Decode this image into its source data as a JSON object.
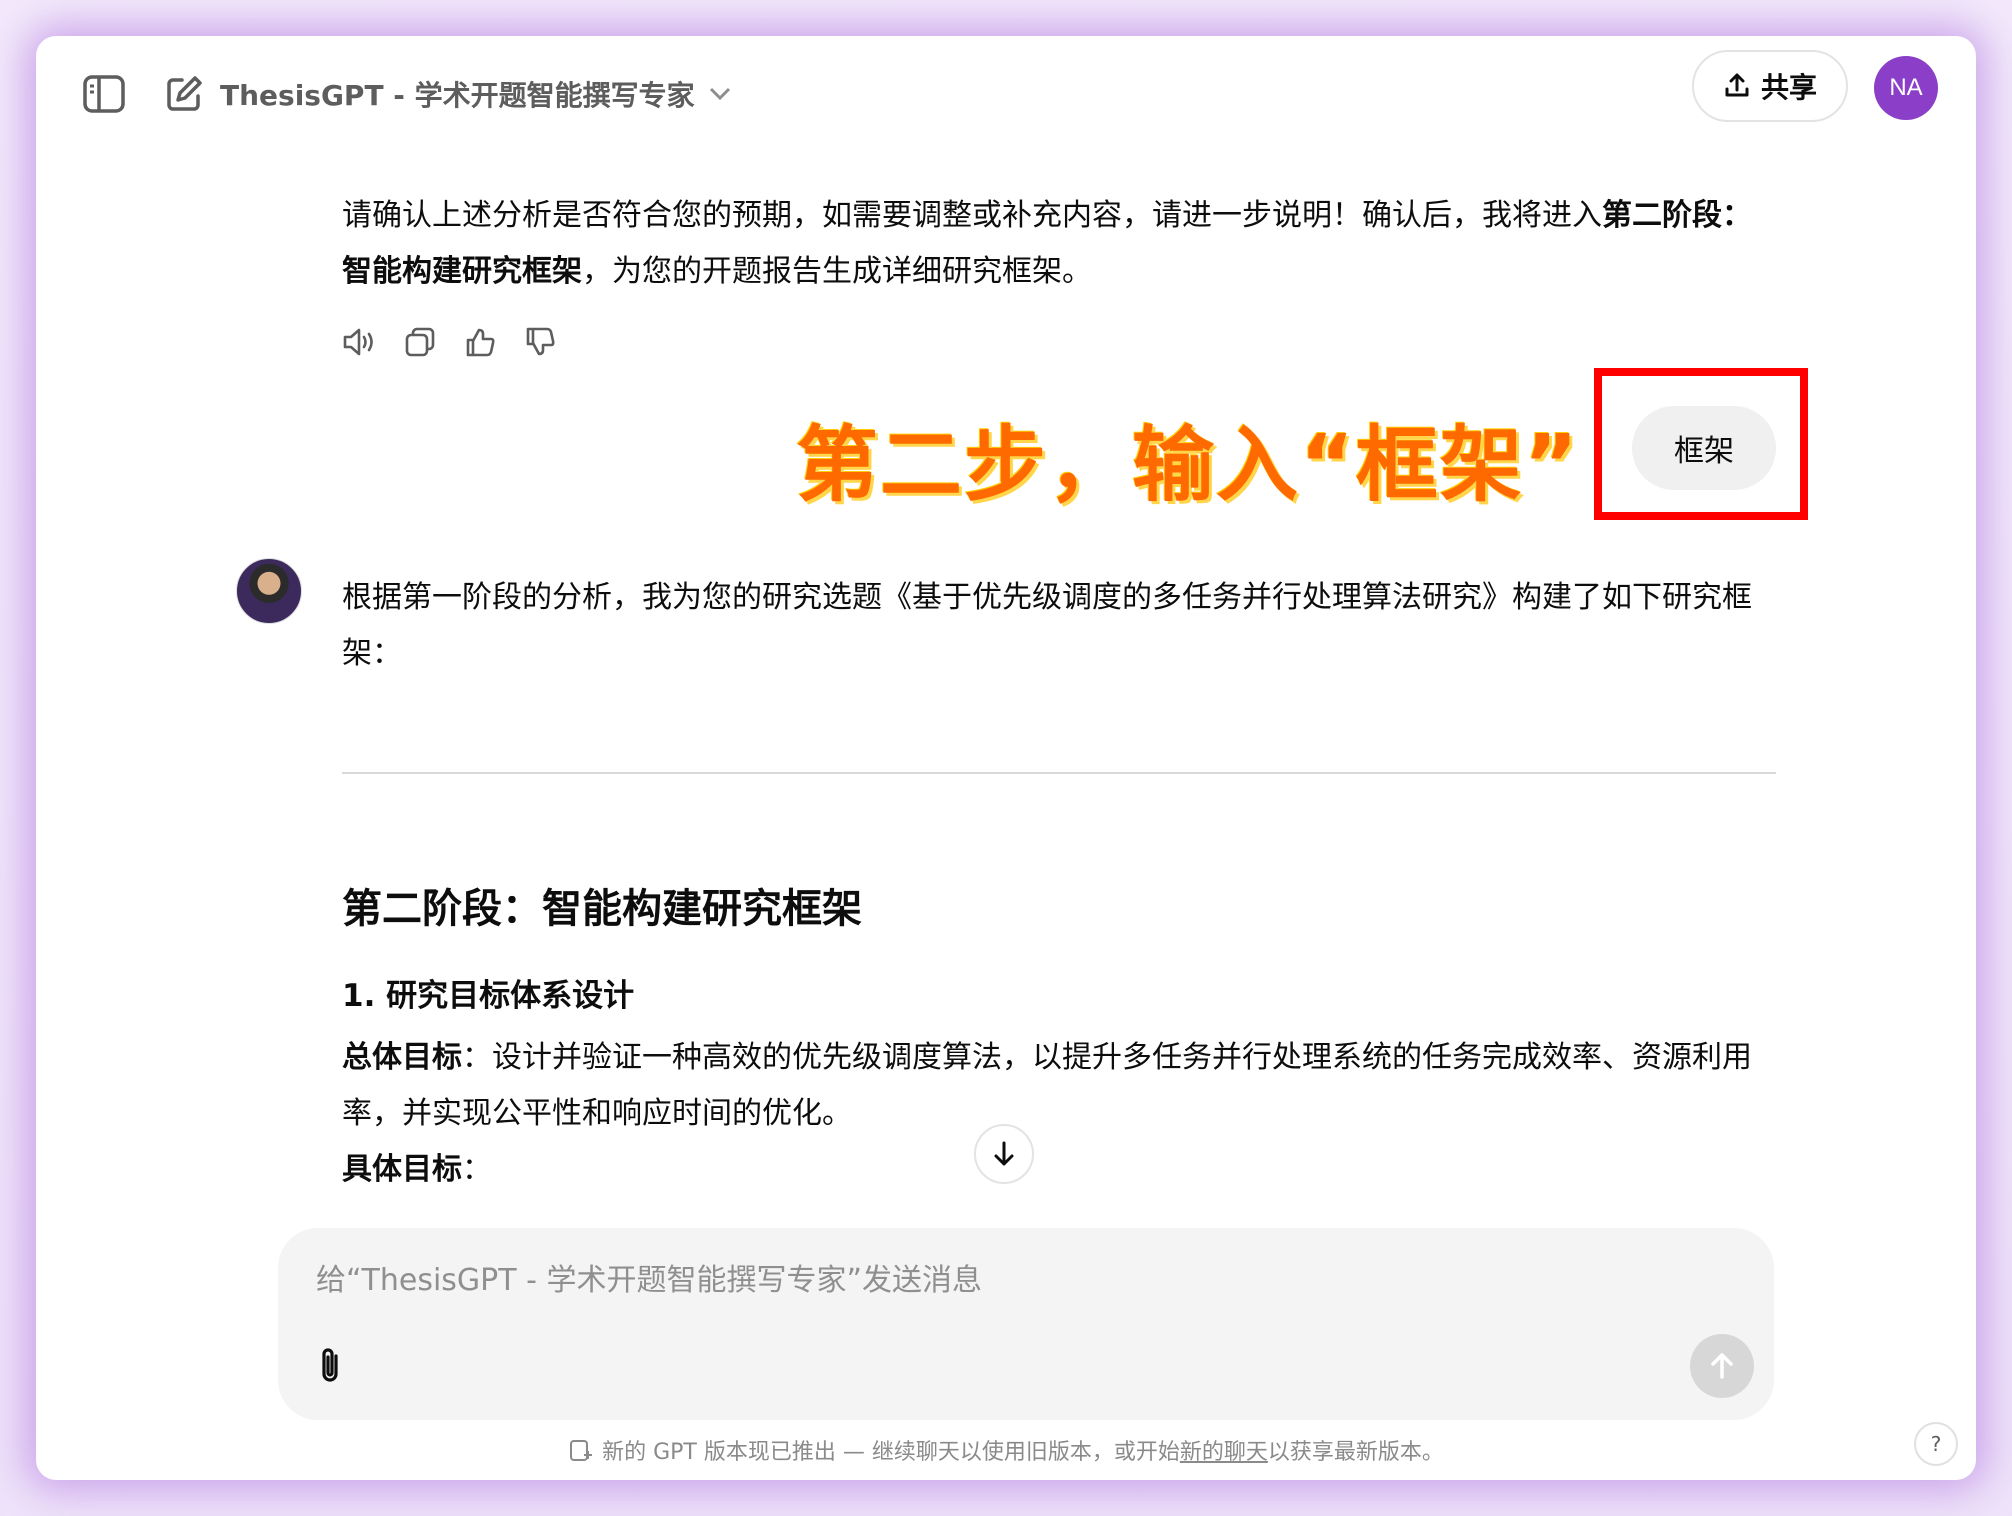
{
  "header": {
    "model_title": "ThesisGPT - 学术开题智能撰写专家",
    "share_label": "共享",
    "avatar_initials": "NA"
  },
  "assistant_prev": {
    "text_before": "请确认上述分析是否符合您的预期，如需要调整或补充内容，请进一步说明！确认后，我将进入",
    "bold_phrase": "第二阶段：智能构建研究框架",
    "text_after": "，为您的开题报告生成详细研究框架。",
    "actions": [
      "read-aloud-icon",
      "copy-icon",
      "thumbs-up-icon",
      "thumbs-down-icon"
    ]
  },
  "annotation": {
    "overlay_text": "第二步，输入“框架”",
    "color": "#ff6a00"
  },
  "user_message": {
    "text": "框架"
  },
  "assistant_reply": {
    "intro": "根据第一阶段的分析，我为您的研究选题《基于优先级调度的多任务并行处理算法研究》构建了如下研究框架：",
    "section_title": "第二阶段：智能构建研究框架",
    "subsection_title": "1. 研究目标体系设计",
    "overall_goal_label": "总体目标",
    "overall_goal_text": "：设计并验证一种高效的优先级调度算法，以提升多任务并行处理系统的任务完成效率、资源利用率，并实现公平性和响应时间的优化。",
    "specific_goal_label": "具体目标",
    "specific_goal_colon": "："
  },
  "composer": {
    "placeholder": "给“ThesisGPT - 学术开题智能撰写专家”发送消息"
  },
  "footer": {
    "lead": "新的 GPT 版本现已推出",
    "dash": " — 继续聊天以使用旧版本，或开始",
    "link": "新的聊天",
    "tail": "以获享最新版本。",
    "help": "?"
  },
  "colors": {
    "accent_avatar": "#8b3fc8",
    "annotation_box": "#ff0000"
  }
}
